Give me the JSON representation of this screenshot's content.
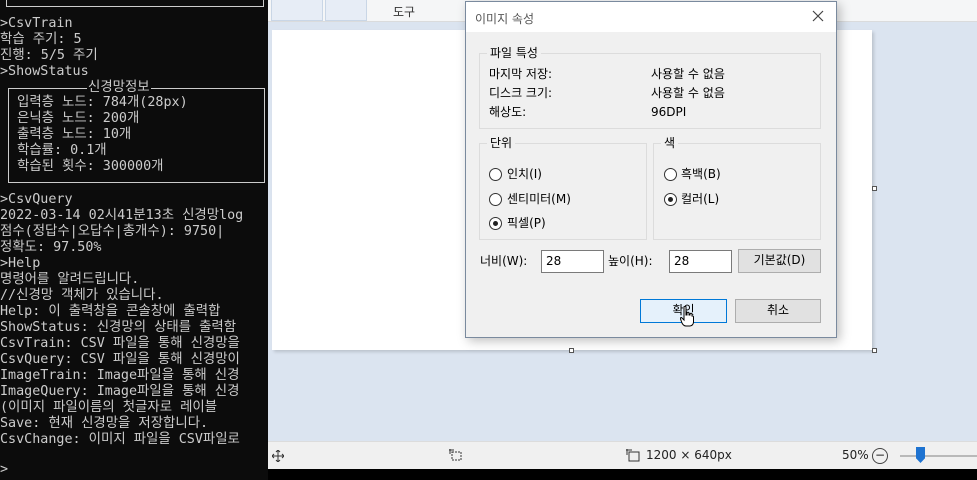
{
  "console": {
    "lines": [
      ">CsvTrain",
      "학습 주기: 5",
      "진행: 5/5 주기",
      ">ShowStatus"
    ],
    "status_box": {
      "title": "신경망정보",
      "lines": [
        "입력층 노드: 784개(28px)",
        "은닉층 노드: 200개",
        "출력층 노드: 10개",
        "학습률: 0.1개",
        "학습된 횟수: 300000개"
      ]
    },
    "lines2": [
      ">CsvQuery",
      "2022-03-14 02시41분13초 신경망log",
      "점수(정답수|오답수|총개수): 9750|",
      "정확도: 97.50%",
      ">Help",
      "명령어를 알려드립니다.",
      "//신경망 객체가 있습니다.",
      "Help: 이 출력창을 콘솔창에 출력합",
      "ShowStatus: 신경망의 상태를 출력함",
      "CsvTrain: CSV 파일을 통해 신경망을",
      "CsvQuery: CSV 파일을 통해 신경망이",
      "ImageTrain: Image파일을 통해 신경",
      "ImageQuery: Image파일을 통해 신경",
      "(이미지 파일이름의 첫글자로 레이블",
      "Save: 현재 신경망을 저장합니다.",
      "CsvChange: 이미지 파일을 CSV파일로"
    ],
    "prompt": ">"
  },
  "paint": {
    "ribbon_tab_tools": "도구",
    "status": {
      "dimensions": "1200 × 640px",
      "zoom": "50%",
      "zoom_level": 0.5
    },
    "icons": [
      "move-cursor-icon",
      "selection-icon",
      "image-size-icon",
      "zoom-out-icon",
      "zoom-slider"
    ]
  },
  "dialog": {
    "title": "이미지 속성",
    "file_props": {
      "legend": "파일 특성",
      "rows": [
        {
          "label": "마지막 저장:",
          "value": "사용할 수 없음"
        },
        {
          "label": "디스크 크기:",
          "value": "사용할 수 없음"
        },
        {
          "label": "해상도:",
          "value": "96DPI"
        }
      ]
    },
    "units": {
      "legend": "단위",
      "options": [
        "인치(I)",
        "센티미터(M)",
        "픽셀(P)"
      ],
      "selected": "픽셀(P)"
    },
    "colors": {
      "legend": "색",
      "options": [
        "흑백(B)",
        "컬러(L)"
      ],
      "selected": "컬러(L)"
    },
    "width_label": "너비(W):",
    "width_value": "28",
    "height_label": "높이(H):",
    "height_value": "28",
    "default_button": "기본값(D)",
    "ok_button": "확인",
    "cancel_button": "취소"
  }
}
